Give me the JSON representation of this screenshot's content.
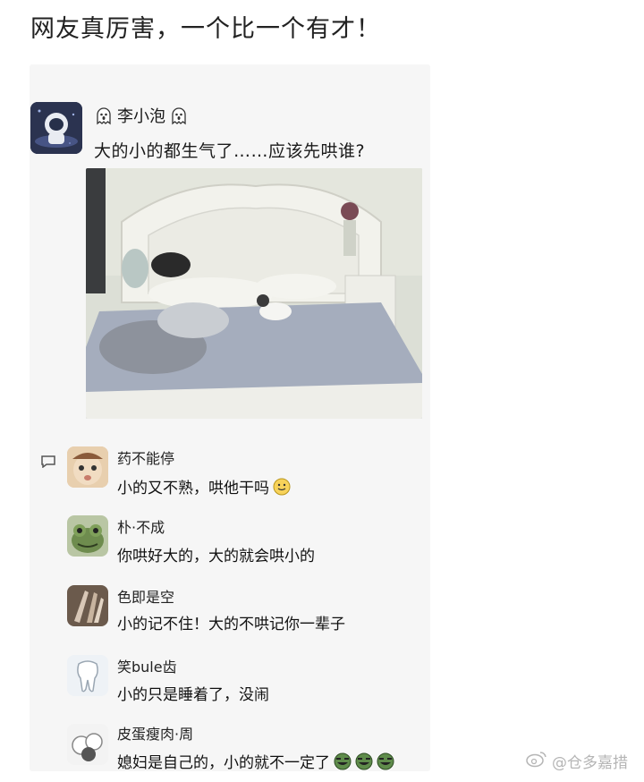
{
  "headline": "网友真厉害，一个比一个有才！",
  "post": {
    "author": "李小泡",
    "text": "大的小的都生气了……应该先哄谁?"
  },
  "comments": [
    {
      "name": "药不能停",
      "text": "小的又不熟，哄他干吗"
    },
    {
      "name": "朴·不成",
      "text": "你哄好大的，大的就会哄小的"
    },
    {
      "name": "色即是空",
      "text": "小的记不住！大的不哄记你一辈子"
    },
    {
      "name": "笑bule齿",
      "text": "小的只是睡着了，没闹"
    },
    {
      "name": "皮蛋瘦肉·周",
      "text": "媳妇是自己的，小的就不一定了"
    }
  ],
  "watermark": "@仓多嘉措"
}
